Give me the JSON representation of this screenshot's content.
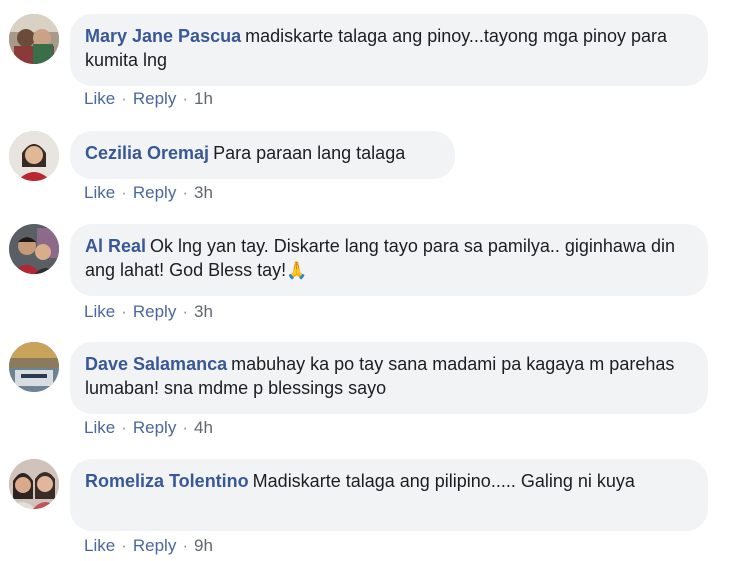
{
  "comments": [
    {
      "author": "Mary Jane Pascua",
      "text": "madiskarte talaga ang pinoy...tayong mga pinoy para kumita lng",
      "like": "Like",
      "reply": "Reply",
      "time": "1h",
      "avatar_icon": "profile-photo"
    },
    {
      "author": "Cezilia Oremaj",
      "text": "Para paraan lang talaga",
      "like": "Like",
      "reply": "Reply",
      "time": "3h",
      "avatar_icon": "profile-photo"
    },
    {
      "author": "Al Real",
      "text": "Ok lng yan tay. Diskarte lang tayo para sa pamilya.. giginhawa din ang lahat! God Bless tay!",
      "emoji": "🙏",
      "like": "Like",
      "reply": "Reply",
      "time": "3h",
      "avatar_icon": "profile-photo"
    },
    {
      "author": "Dave Salamanca",
      "text": "mabuhay ka po tay sana madami pa kagaya m parehas lumaban! sna mdme p blessings sayo",
      "like": "Like",
      "reply": "Reply",
      "time": "4h",
      "avatar_icon": "profile-photo"
    },
    {
      "author": "Romeliza Tolentino",
      "text": "Madiskarte talaga ang pilipino..... Galing ni kuya",
      "like": "Like",
      "reply": "Reply",
      "time": "9h",
      "avatar_icon": "profile-photo"
    }
  ],
  "separator": "·"
}
